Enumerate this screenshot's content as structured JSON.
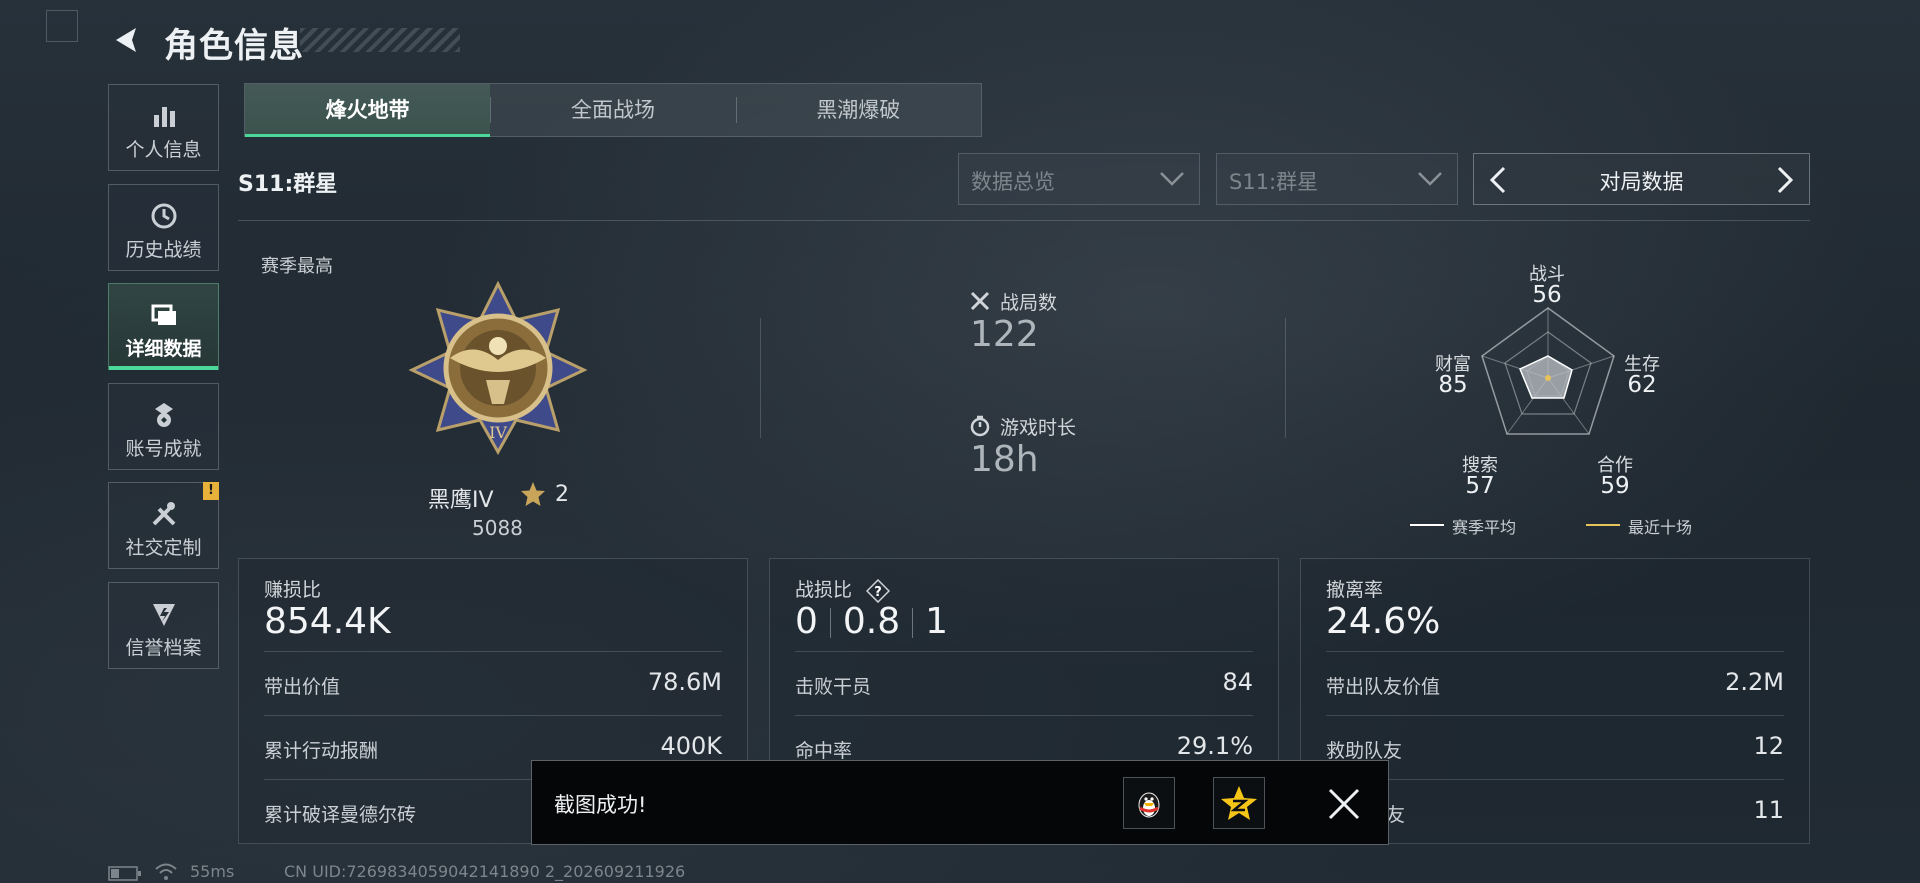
{
  "header": {
    "title": "角色信息"
  },
  "sidebar": {
    "items": [
      {
        "label": "个人信息",
        "icon": "bar-chart-icon"
      },
      {
        "label": "历史战绩",
        "icon": "clock-icon"
      },
      {
        "label": "详细数据",
        "icon": "folders-icon",
        "active": true
      },
      {
        "label": "账号成就",
        "icon": "medal-icon"
      },
      {
        "label": "社交定制",
        "icon": "tools-icon",
        "badge": "!"
      },
      {
        "label": "信誉档案",
        "icon": "shield-icon"
      }
    ]
  },
  "tabs": [
    {
      "label": "烽火地带",
      "active": true
    },
    {
      "label": "全面战场"
    },
    {
      "label": "黑潮爆破"
    }
  ],
  "season_label": "S11:群星",
  "filters": {
    "data_type": "数据总览",
    "season": "S11:群星",
    "mode_label": "对局数据"
  },
  "overview": {
    "season_best_label": "赛季最高",
    "rank_name": "黑鹰IV",
    "rank_stars": "2",
    "rank_score": "5088",
    "matches_label": "战局数",
    "matches_value": "122",
    "playtime_label": "游戏时长",
    "playtime_value": "18h"
  },
  "radar": {
    "axes": [
      {
        "label": "战斗",
        "value": "56"
      },
      {
        "label": "生存",
        "value": "62"
      },
      {
        "label": "合作",
        "value": "59"
      },
      {
        "label": "搜索",
        "value": "57"
      },
      {
        "label": "财富",
        "value": "85"
      }
    ],
    "legend": [
      {
        "label": "赛季平均",
        "color": "#ffffff"
      },
      {
        "label": "最近十场",
        "color": "#e8c25a"
      }
    ]
  },
  "cards": {
    "profit": {
      "title": "赚损比",
      "big": "854.4K",
      "rows": [
        {
          "label": "带出价值",
          "value": "78.6M"
        },
        {
          "label": "累计行动报酬",
          "value": "400K"
        },
        {
          "label": "累计破译曼德尔砖",
          "value": ""
        }
      ]
    },
    "combat": {
      "title": "战损比",
      "ratio": [
        "0",
        "0.8",
        "1"
      ],
      "rows": [
        {
          "label": "击败干员",
          "value": "84"
        },
        {
          "label": "命中率",
          "value": "29.1%"
        },
        {
          "label": "",
          "value": ""
        }
      ]
    },
    "extract": {
      "title": "撤离率",
      "big": "24.6%",
      "rows": [
        {
          "label": "带出队友价值",
          "value": "2.2M"
        },
        {
          "label": "救助队友",
          "value": "12"
        },
        {
          "label": "友",
          "value": "11"
        }
      ]
    }
  },
  "toast": {
    "message": "截图成功!"
  },
  "status": {
    "ping": "55ms",
    "uid": "CN UID:7269834059042141890 2_202609211926"
  }
}
